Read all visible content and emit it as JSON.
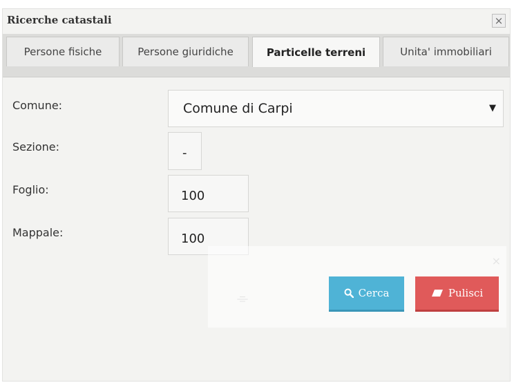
{
  "window": {
    "title": "Ricerche catastali",
    "close_glyph": "×"
  },
  "tabs": [
    {
      "label": "Persone fisiche",
      "active": false
    },
    {
      "label": "Persone giuridiche",
      "active": false
    },
    {
      "label": "Particelle terreni",
      "active": true
    },
    {
      "label": "Unita' immobiliari",
      "active": false
    }
  ],
  "form": {
    "comune": {
      "label": "Comune:",
      "value": "Comune di Carpi",
      "arrow": "▼"
    },
    "sezione": {
      "label": "Sezione:",
      "value": "-"
    },
    "foglio": {
      "label": "Foglio:",
      "value": "100"
    },
    "mappale": {
      "label": "Mappale:",
      "value": "100"
    }
  },
  "actions": {
    "search": {
      "label": "Cerca",
      "icon": "search-icon",
      "color": "#4fb3d6"
    },
    "clear": {
      "label": "Pulisci",
      "icon": "eraser-icon",
      "color": "#e05a5a"
    }
  }
}
